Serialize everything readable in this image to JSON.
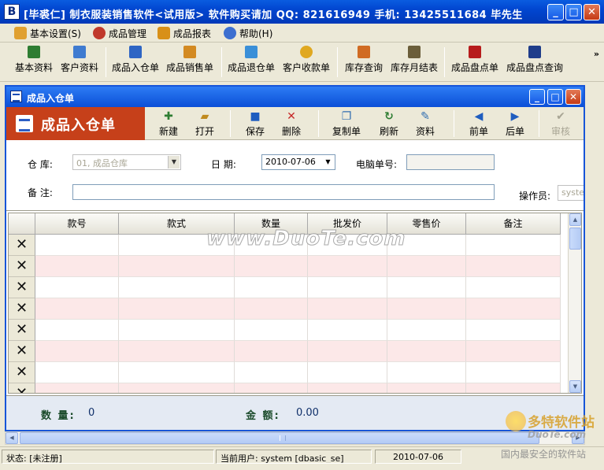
{
  "window": {
    "title": "[毕裘仁] 制衣服装销售软件<试用版>  软件购买请加 QQ: 821616949 手机: 13425511684 毕先生",
    "logo": "B",
    "min_glyph": "_",
    "max_glyph": "□",
    "close_glyph": "✕"
  },
  "menu": [
    {
      "label": "基本设置(S)",
      "icon": "settings-icon",
      "color": "#E0A030"
    },
    {
      "label": "成品管理",
      "icon": "box-icon",
      "color": "#C0392B"
    },
    {
      "label": "成品报表",
      "icon": "report-icon",
      "color": "#D89018"
    },
    {
      "label": "帮助(H)",
      "icon": "help-icon",
      "color": "#3C6FD0"
    }
  ],
  "toolbar": {
    "items": [
      {
        "label": "基本资料",
        "color": "#2E7D32"
      },
      {
        "label": "客户资料",
        "color": "#3F7BD0"
      },
      {
        "label": "成品入仓单",
        "color": "#2E65C4"
      },
      {
        "label": "成品销售单",
        "color": "#D38A22"
      },
      {
        "label": "成品退仓单",
        "color": "#3A8FD8"
      },
      {
        "label": "客户收款单",
        "color": "#E0A820"
      },
      {
        "label": "库存查询",
        "color": "#D06B23"
      },
      {
        "label": "库存月结表",
        "color": "#6B5E3A"
      },
      {
        "label": "成品盘点单",
        "color": "#B71C1C"
      },
      {
        "label": "成品盘点查询",
        "color": "#1F3D8A"
      }
    ],
    "more": "»"
  },
  "doc_window": {
    "title": "成品入仓单",
    "banner": "成品入仓单",
    "buttons": [
      {
        "label": "新建",
        "glyph": "✚",
        "color": "#2E7D32",
        "disabled": false
      },
      {
        "label": "打开",
        "glyph": "▰",
        "color": "#C08A1E",
        "disabled": false
      },
      {
        "label": "保存",
        "glyph": "■",
        "color": "#1F5DBF",
        "disabled": false
      },
      {
        "label": "删除",
        "glyph": "✕",
        "color": "#C62828",
        "disabled": false
      },
      {
        "label": "复制单",
        "glyph": "❐",
        "color": "#2F6DB0",
        "disabled": false
      },
      {
        "label": "刷新",
        "glyph": "↻",
        "color": "#2E7D32",
        "disabled": false
      },
      {
        "label": "资料",
        "glyph": "✎",
        "color": "#2F6DB0",
        "disabled": false
      },
      {
        "label": "前单",
        "glyph": "◀",
        "color": "#1F5DBF",
        "disabled": false
      },
      {
        "label": "后单",
        "glyph": "▶",
        "color": "#1F5DBF",
        "disabled": false
      },
      {
        "label": "审核",
        "glyph": "✔",
        "color": "#A8A594",
        "disabled": true
      }
    ]
  },
  "form": {
    "warehouse_label": "仓 库:",
    "warehouse_value": "01, 成品仓库",
    "date_label": "日 期:",
    "date_value": "2010-07-06",
    "doc_no_label": "电脑单号:",
    "doc_no_value": "",
    "remark_label": "备 注:",
    "remark_value": "",
    "operator_label": "操作员:",
    "operator_value": "system"
  },
  "grid": {
    "columns": [
      "款号",
      "款式",
      "数量",
      "批发价",
      "零售价",
      "备注"
    ],
    "row_count": 8,
    "delete_glyph": "✕"
  },
  "totals": {
    "qty_label": "数 量:",
    "qty_value": "0",
    "amount_label": "金 额:",
    "amount_value": "0.00"
  },
  "statusbar": {
    "status": "状态: [未注册]",
    "user": "当前用户: system [dbasic_se]",
    "date": "2010-07-06"
  },
  "watermarks": {
    "center": "www.DuoTe.com",
    "corner_top": "多特软件站",
    "corner_mid": "DuoTe.com",
    "corner_bottom": "国内最安全的软件站"
  }
}
